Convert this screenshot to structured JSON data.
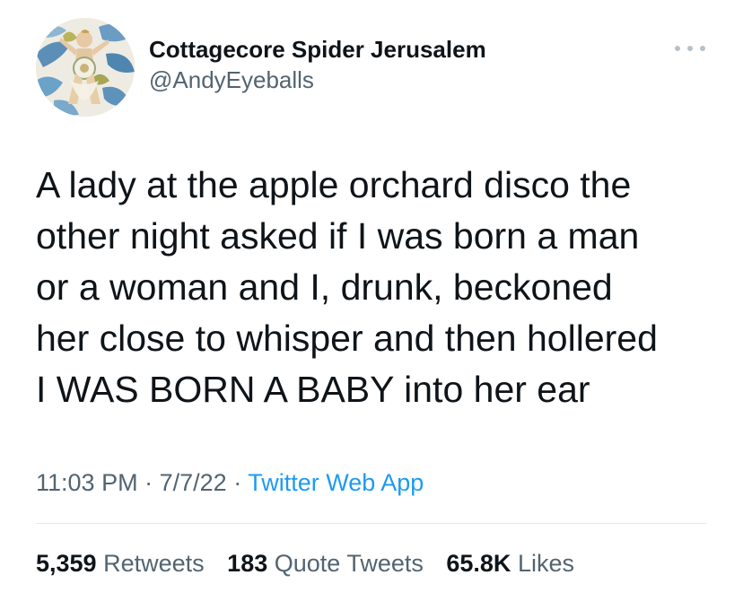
{
  "author": {
    "display_name": "Cottagecore Spider Jerusalem",
    "handle": "@AndyEyeballs",
    "avatar_icon": "illustrated-figure-avatar"
  },
  "more_icon": "more-dots-icon",
  "tweet": {
    "text": "A lady at the apple orchard disco the\nother night asked if I was born a man\nor a woman and I, drunk, beckoned\nher close to whisper and then hollered\nI WAS BORN A BABY into her ear"
  },
  "meta": {
    "time": "11:03 PM",
    "separator1": "·",
    "date": "7/7/22",
    "separator2": "·",
    "app": "Twitter Web App"
  },
  "stats": {
    "retweets_count": "5,359",
    "retweets_label": "Retweets",
    "quotes_count": "183",
    "quotes_label": "Quote Tweets",
    "likes_count": "65.8K",
    "likes_label": "Likes"
  },
  "colors": {
    "text_primary": "#0f1419",
    "text_secondary": "#536471",
    "link": "#1d9bf0",
    "divider": "#e4e8eb"
  }
}
